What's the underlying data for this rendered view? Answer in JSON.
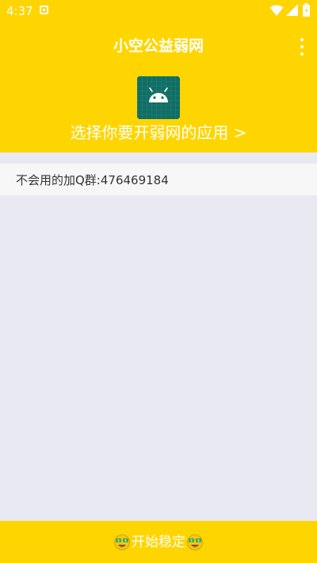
{
  "status_bar": {
    "time": "4:37",
    "icons": [
      "notification-icon",
      "wifi-icon",
      "signal-icon",
      "battery-icon"
    ]
  },
  "app_bar": {
    "title": "小空公益弱网",
    "menu_icon": "more-vert-icon"
  },
  "header": {
    "app_icon": "android-icon",
    "select_app_label": "选择你要开弱网的应用 >"
  },
  "content": {
    "info_text": "不会用的加Q群:476469184"
  },
  "start_button": {
    "label": "开始稳定",
    "left_icon": "money-face-emoji-icon",
    "right_icon": "money-face-emoji-icon"
  },
  "colors": {
    "primary": "#ffd500",
    "background": "#e9e9f1",
    "row_background": "#f7f7f7",
    "app_icon_bg": "#0f6e65",
    "text_on_primary": "#ffffff",
    "body_text": "#333333"
  }
}
